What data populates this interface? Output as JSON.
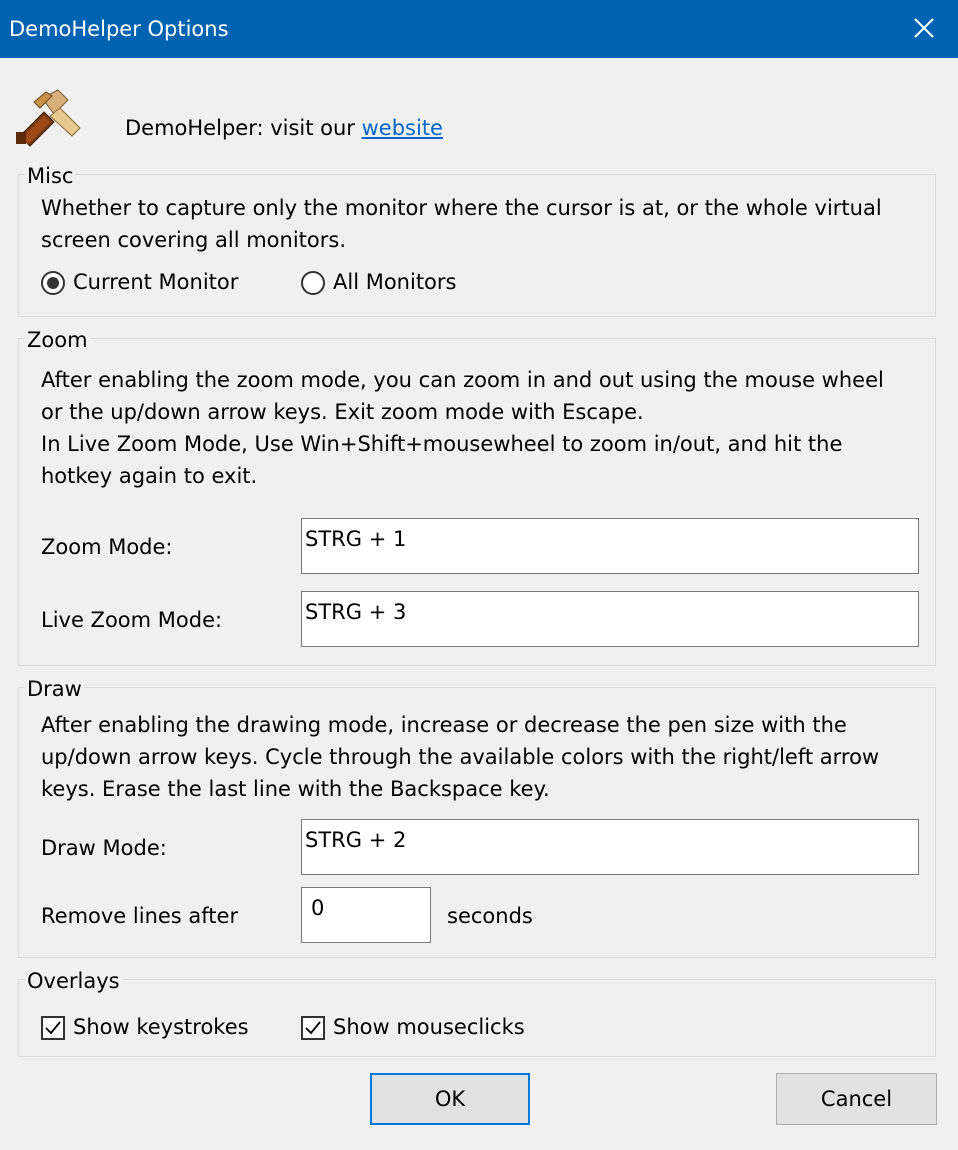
{
  "window": {
    "title": "DemoHelper Options"
  },
  "header": {
    "text": "DemoHelper: visit our ",
    "link": "website"
  },
  "misc": {
    "legend": "Misc",
    "description_line1": "Whether to capture only the monitor where the cursor is at, or the whole virtual",
    "description_line2": "screen covering all monitors.",
    "options": [
      {
        "label": "Current Monitor",
        "selected": true
      },
      {
        "label": "All Monitors",
        "selected": false
      }
    ]
  },
  "zoom": {
    "legend": "Zoom",
    "description_line1": "After enabling the zoom mode, you can zoom in and out using the mouse wheel",
    "description_line2": "or the up/down arrow keys. Exit zoom mode with Escape.",
    "description_line3": "In Live Zoom Mode, Use Win+Shift+mousewheel to zoom in/out, and hit the",
    "description_line4": "hotkey again to exit.",
    "zoom_mode_label": "Zoom Mode:",
    "zoom_mode_value": "STRG + 1",
    "live_zoom_label": "Live Zoom Mode:",
    "live_zoom_value": "STRG + 3"
  },
  "draw": {
    "legend": "Draw",
    "description_line1": "After enabling the drawing mode, increase or decrease the pen size with the",
    "description_line2": "up/down arrow keys. Cycle through the available colors with the right/left arrow",
    "description_line3": "keys. Erase the last line with the Backspace key.",
    "draw_mode_label": "Draw Mode:",
    "draw_mode_value": "STRG + 2",
    "remove_label": "Remove lines after",
    "remove_value": "0",
    "seconds_label": "seconds"
  },
  "overlays": {
    "legend": "Overlays",
    "show_keystrokes": "Show keystrokes",
    "show_keystrokes_checked": true,
    "show_mouseclicks": "Show mouseclicks",
    "show_mouseclicks_checked": true
  },
  "buttons": {
    "ok": "OK",
    "cancel": "Cancel"
  },
  "colors": {
    "titlebar": "#0063b1",
    "link": "#0066cc",
    "focus": "#0078d7"
  }
}
